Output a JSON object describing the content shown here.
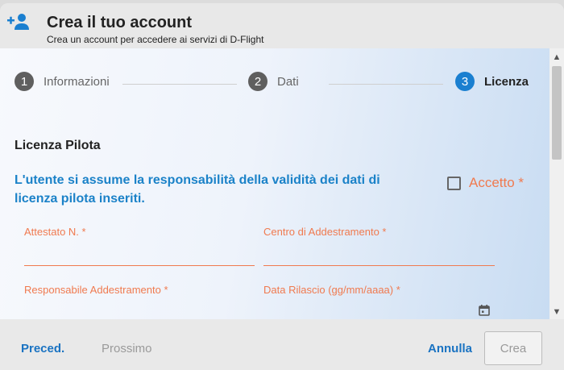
{
  "header": {
    "title": "Crea il tuo account",
    "subtitle": "Crea un account per accedere ai servizi di D-Flight",
    "icon": "add-user-icon"
  },
  "stepper": {
    "steps": [
      {
        "number": "1",
        "label": "Informazioni",
        "active": false
      },
      {
        "number": "2",
        "label": "Dati",
        "active": false
      },
      {
        "number": "3",
        "label": "Licenza",
        "active": true
      }
    ]
  },
  "section": {
    "title": "Licenza Pilota",
    "disclaimer": "L'utente si assume la responsabilità della validità dei dati di licenza pilota inseriti.",
    "accept_label": "Accetto *"
  },
  "fields": {
    "attestato": {
      "label": "Attestato N. *",
      "value": ""
    },
    "centro": {
      "label": "Centro di Addestramento *",
      "value": ""
    },
    "responsabile": {
      "label": "Responsabile Addestramento *",
      "value": ""
    },
    "data_rilascio": {
      "label": "Data Rilascio (gg/mm/aaaa) *",
      "value": ""
    }
  },
  "footer": {
    "prev_label": "Preced.",
    "next_label": "Prossimo",
    "cancel_label": "Annulla",
    "create_label": "Crea"
  },
  "colors": {
    "accent": "#1a7fd0",
    "required": "#f07a4f",
    "disclaimer": "#1b82c8"
  }
}
